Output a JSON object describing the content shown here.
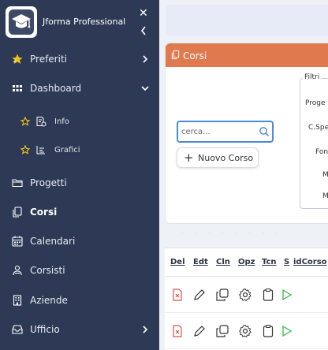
{
  "sidebar": {
    "brand_name": "Jforma Professional",
    "items": [
      {
        "label": "Preferiti",
        "icon": "star-icon",
        "chevron": "right"
      },
      {
        "label": "Dashboard",
        "icon": "grid-icon",
        "chevron": "down"
      },
      {
        "label": "Progetti",
        "icon": "folders-icon"
      },
      {
        "label": "Corsi",
        "icon": "copy-icon",
        "active": true
      },
      {
        "label": "Calendari",
        "icon": "calendar-icon"
      },
      {
        "label": "Corsisti",
        "icon": "users-icon"
      },
      {
        "label": "Aziende",
        "icon": "building-icon"
      },
      {
        "label": "Ufficio",
        "icon": "inbox-icon",
        "chevron": "right"
      }
    ],
    "sub_items": [
      {
        "label": "Info",
        "icon": "info-document-icon"
      },
      {
        "label": "Grafici",
        "icon": "bar-chart-icon"
      }
    ]
  },
  "card": {
    "title": "Corsi",
    "search_placeholder": "cerca...",
    "new_button_label": "Nuovo Corso",
    "filters": {
      "legend": "Filtri",
      "labels": [
        "Proge",
        "C.Spe",
        "Fon",
        "M",
        "M"
      ]
    }
  },
  "table": {
    "headers": [
      "Del",
      "Edt",
      "Cln",
      "Opz",
      "Tcn",
      "S",
      "idCorso"
    ]
  },
  "colors": {
    "sidebar_bg": "#2e3a55",
    "accent_orange": "#e07a4e",
    "search_border": "#4a8bd6",
    "star_yellow": "#f0c419",
    "delete_red": "#d9534f",
    "play_green": "#3cb54a"
  }
}
